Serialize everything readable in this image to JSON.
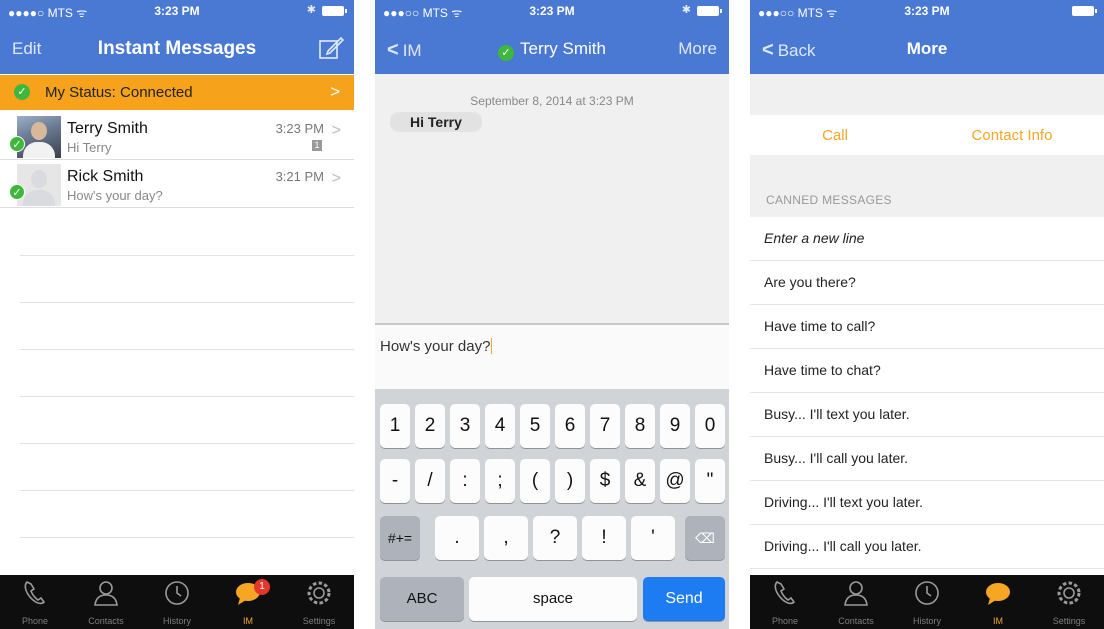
{
  "status_bar": {
    "carrier": "●●●●○ MTS ᯤ",
    "carrier_dim": "●●●○○ MTS ᯤ",
    "time": "3:23 PM"
  },
  "screen1": {
    "nav": {
      "left": "Edit",
      "title": "Instant Messages"
    },
    "my_status": {
      "label": "My Status: Connected",
      "arrow": ">"
    },
    "contacts": [
      {
        "name": "Terry Smith",
        "preview": "Hi Terry",
        "time": "3:23 PM",
        "unread": "1",
        "online": true
      },
      {
        "name": "Rick Smith",
        "preview": "How's your day?",
        "time": "3:21 PM",
        "online": true
      }
    ]
  },
  "screen2": {
    "nav": {
      "back": "IM",
      "title": "Terry Smith",
      "right": "More"
    },
    "date": "September 8, 2014 at 3:23 PM",
    "message": "Hi Terry",
    "input_text": "How's your day?",
    "keyboard": {
      "row1": [
        "1",
        "2",
        "3",
        "4",
        "5",
        "6",
        "7",
        "8",
        "9",
        "0"
      ],
      "row2": [
        "-",
        "/",
        ":",
        ";",
        "(",
        ")",
        "$",
        "&",
        "@",
        "\""
      ],
      "row3_left": "#+=",
      "row3": [
        ".",
        ",",
        "?",
        "!",
        "'"
      ],
      "row4": {
        "abc": "ABC",
        "space": "space",
        "send": "Send"
      }
    }
  },
  "screen3": {
    "nav": {
      "back": "Back",
      "title": "More"
    },
    "actions": {
      "call": "Call",
      "contact_info": "Contact Info"
    },
    "section_header": "CANNED MESSAGES",
    "canned": [
      "Enter a new line",
      "Are you there?",
      "Have time to call?",
      "Have time to chat?",
      "Busy... I'll text you later.",
      "Busy... I'll call you later.",
      "Driving... I'll text you later.",
      "Driving... I'll call you later."
    ]
  },
  "tabbar": {
    "tabs": [
      {
        "label": "Phone",
        "icon": "phone-icon"
      },
      {
        "label": "Contacts",
        "icon": "contacts-icon"
      },
      {
        "label": "History",
        "icon": "clock-icon"
      },
      {
        "label": "IM",
        "icon": "chat-bubble-icon"
      },
      {
        "label": "Settings",
        "icon": "gear-icon"
      }
    ],
    "im_badge": "1"
  },
  "colors": {
    "nav_blue": "#4a79d3",
    "status_orange": "#f6a21a",
    "accent_orange": "#f5a623",
    "online_green": "#3fb73c",
    "send_blue": "#1e7cf2"
  }
}
